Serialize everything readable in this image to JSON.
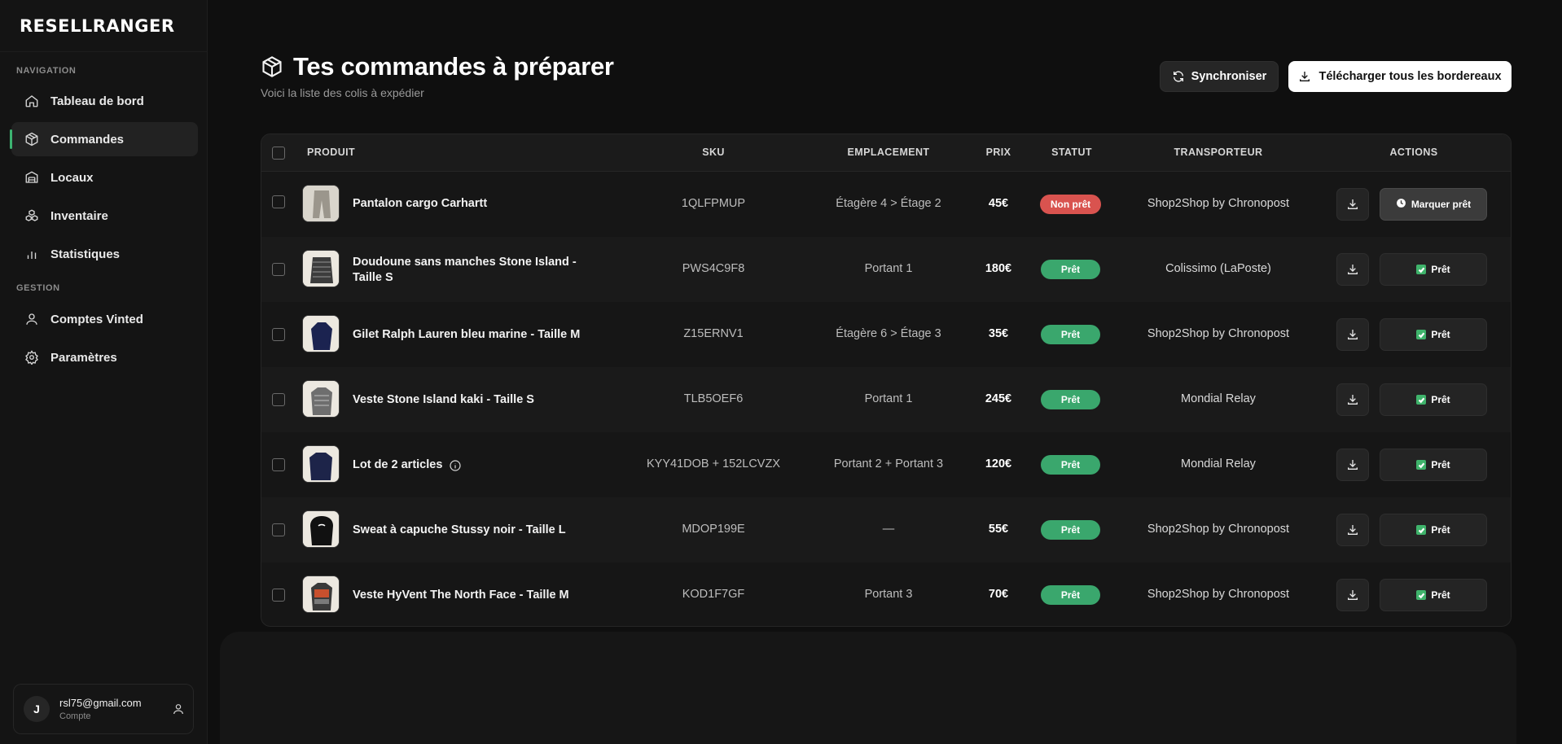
{
  "app": {
    "brand": "RESELLRANGER"
  },
  "sidebar": {
    "navigation_title": "NAVIGATION",
    "gestion_title": "GESTION",
    "items": [
      {
        "label": "Tableau de bord",
        "icon": "home-icon"
      },
      {
        "label": "Commandes",
        "icon": "package-icon",
        "active": true
      },
      {
        "label": "Locaux",
        "icon": "storage-icon"
      },
      {
        "label": "Inventaire",
        "icon": "boxes-icon"
      },
      {
        "label": "Statistiques",
        "icon": "bar-chart-icon"
      },
      {
        "label": "Comptes Vinted",
        "icon": "user-icon"
      },
      {
        "label": "Paramètres",
        "icon": "gear-icon"
      }
    ],
    "account": {
      "initial": "J",
      "email": "rsl75@gmail.com",
      "sub": "Compte"
    }
  },
  "header": {
    "title": "Tes commandes à préparer",
    "subtitle": "Voici la liste des colis à expédier",
    "sync_label": "Synchroniser",
    "download_all_label": "Télécharger tous les bordereaux"
  },
  "table": {
    "columns": [
      "PRODUIT",
      "SKU",
      "EMPLACEMENT",
      "PRIX",
      "STATUT",
      "TRANSPORTEUR",
      "ACTIONS"
    ],
    "rows": [
      {
        "product": "Pantalon cargo Carhartt",
        "sku": "1QLFPMUP",
        "location": "Étagère 4 > Étage 2",
        "price": "45€",
        "status": "Non prêt",
        "carrier": "Shop2Shop by Chronopost",
        "action": "Marquer prêt"
      },
      {
        "product": "Doudoune sans manches Stone Island - Taille S",
        "sku": "PWS4C9F8",
        "location": "Portant 1",
        "price": "180€",
        "status": "Prêt",
        "carrier": "Colissimo (LaPoste)",
        "action": "Prêt"
      },
      {
        "product": "Gilet Ralph Lauren bleu marine - Taille M",
        "sku": "Z15ERNV1",
        "location": "Étagère 6 > Étage 3",
        "price": "35€",
        "status": "Prêt",
        "carrier": "Shop2Shop by Chronopost",
        "action": "Prêt"
      },
      {
        "product": "Veste Stone Island kaki - Taille S",
        "sku": "TLB5OEF6",
        "location": "Portant 1",
        "price": "245€",
        "status": "Prêt",
        "carrier": "Mondial Relay",
        "action": "Prêt"
      },
      {
        "product": "Lot de 2 articles",
        "sku": "KYY41DOB + 152LCVZX",
        "location": "Portant 2 + Portant 3",
        "price": "120€",
        "status": "Prêt",
        "carrier": "Mondial Relay",
        "action": "Prêt"
      },
      {
        "product": "Sweat à capuche Stussy noir - Taille L",
        "sku": "MDOP199E",
        "location": "—",
        "price": "55€",
        "status": "Prêt",
        "carrier": "Shop2Shop by Chronopost",
        "action": "Prêt"
      },
      {
        "product": "Veste HyVent The North Face - Taille M",
        "sku": "KOD1F7GF",
        "location": "Portant 3",
        "price": "70€",
        "status": "Prêt",
        "carrier": "Shop2Shop by Chronopost",
        "action": "Prêt"
      }
    ]
  },
  "colors": {
    "accent_green": "#3aa76d",
    "danger_red": "#d9534f",
    "background": "#0f0f0f"
  }
}
